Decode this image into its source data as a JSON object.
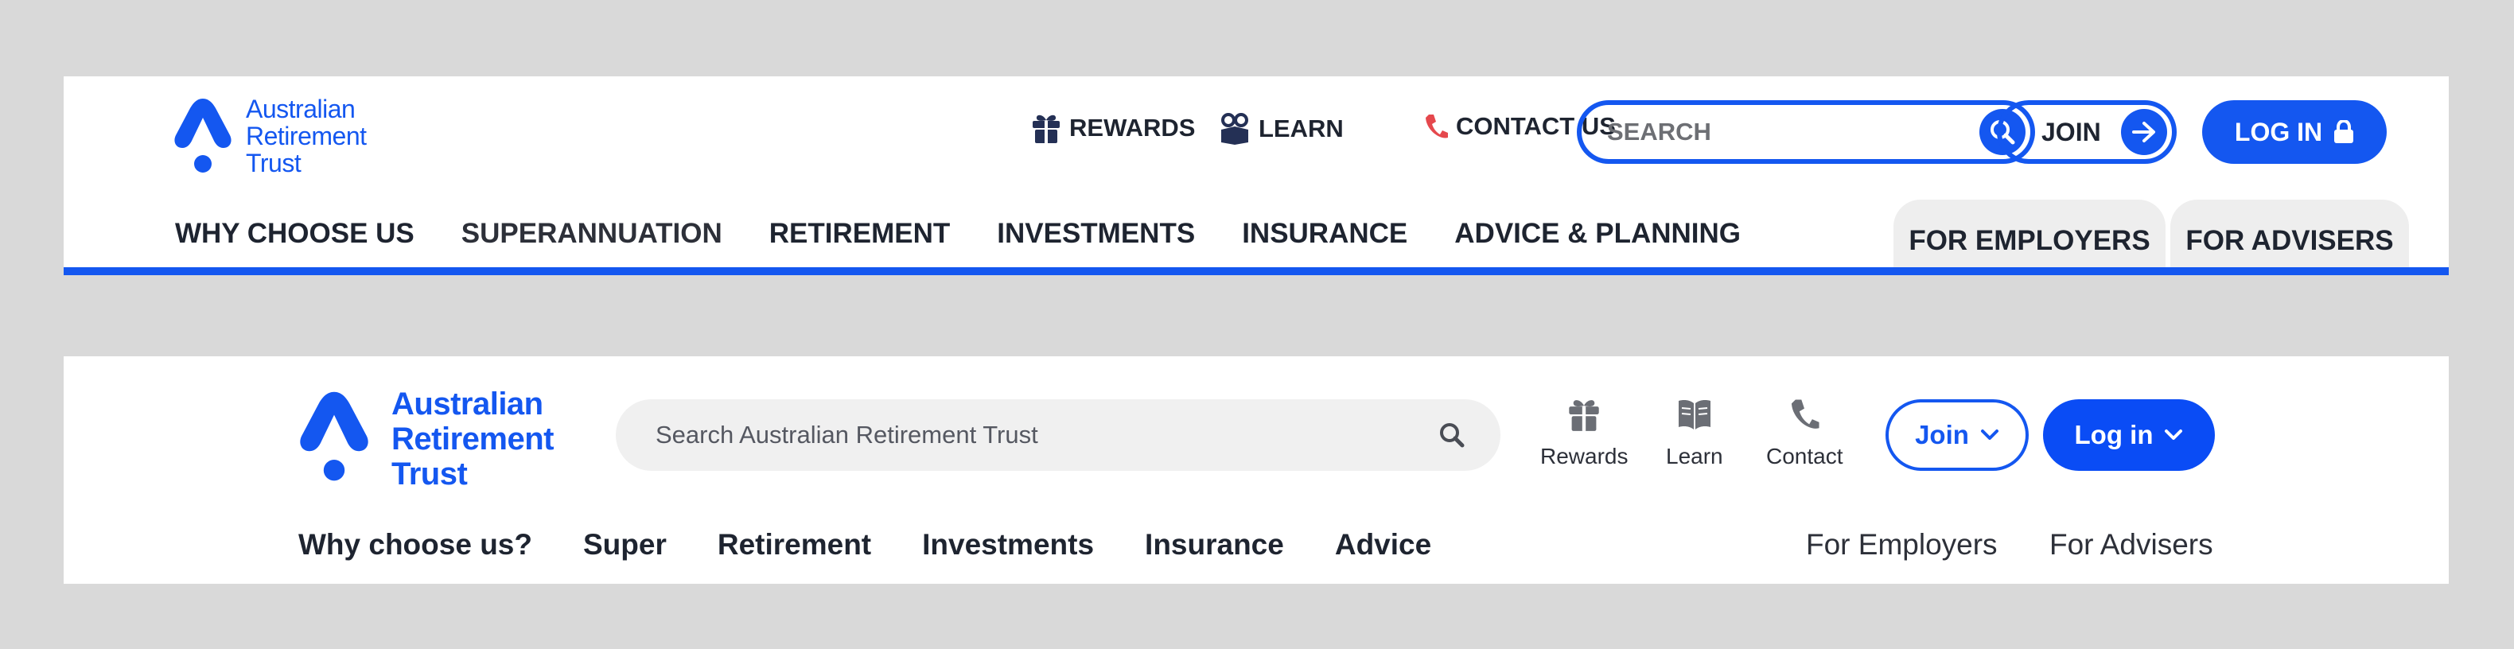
{
  "colors": {
    "brand_blue": "#1457f0",
    "text_dark": "#1e2430",
    "page_bg": "#d9d9d9",
    "tab_bg": "#eeeeee",
    "phone_red": "#e5484d"
  },
  "header1": {
    "logo": {
      "line1": "Australian",
      "line2": "Retirement",
      "line3": "Trust"
    },
    "utility": [
      {
        "label": "REWARDS",
        "icon": "gift-icon"
      },
      {
        "label": "LEARN",
        "icon": "learn-icon"
      },
      {
        "label": "CONTACT US",
        "icon": "phone-icon"
      }
    ],
    "search": {
      "placeholder": "SEARCH",
      "value": ""
    },
    "join_label": "JOIN",
    "login_label": "LOG IN",
    "nav": [
      "WHY CHOOSE US",
      "SUPERANNUATION",
      "RETIREMENT",
      "INVESTMENTS",
      "INSURANCE",
      "ADVICE & PLANNING"
    ],
    "audience": [
      "FOR EMPLOYERS",
      "FOR ADVISERS"
    ]
  },
  "header2": {
    "logo": {
      "line1": "Australian",
      "line2": "Retirement",
      "line3": "Trust"
    },
    "search": {
      "placeholder": "Search Australian Retirement Trust",
      "value": ""
    },
    "utility": [
      {
        "label": "Rewards",
        "icon": "gift-icon"
      },
      {
        "label": "Learn",
        "icon": "book-icon"
      },
      {
        "label": "Contact",
        "icon": "phone-icon"
      }
    ],
    "join_label": "Join",
    "login_label": "Log in",
    "nav": [
      "Why choose us?",
      "Super",
      "Retirement",
      "Investments",
      "Insurance",
      "Advice"
    ],
    "audience": [
      "For Employers",
      "For Advisers"
    ]
  }
}
